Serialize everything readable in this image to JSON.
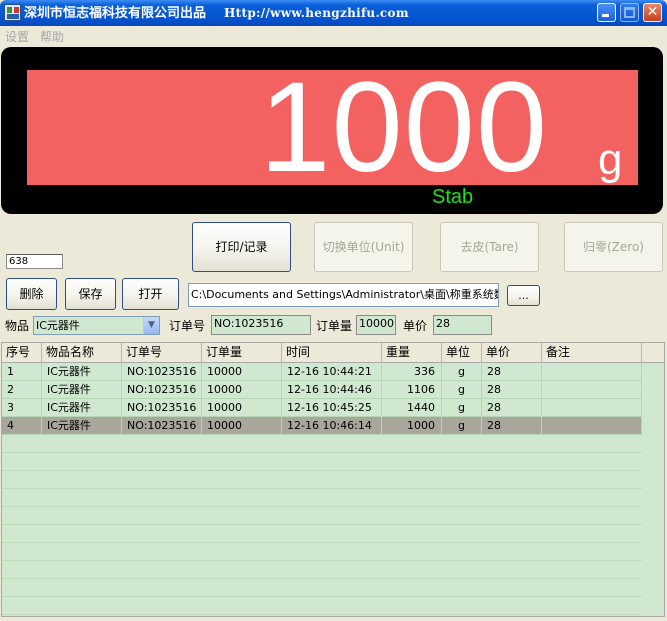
{
  "window": {
    "title": "深圳市恒志福科技有限公司出品",
    "url": "Http://www.hengzhifu.com"
  },
  "menu": [
    "设置",
    "帮助"
  ],
  "display": {
    "weight": "1000",
    "unit": "g",
    "status": "Stab",
    "screen_color": "#f36161"
  },
  "controls": {
    "print_record": "打印/记录",
    "switch_unit": "切换单位(Unit)",
    "tare": "去皮(Tare)",
    "zero": "归零(Zero)",
    "delete": "删除",
    "save": "保存",
    "open": "打开",
    "browse": "...",
    "value_field": "638",
    "file_path": "C:\\Documents and Settings\\Administrator\\桌面\\称重系统数据("
  },
  "item_row": {
    "item_label": "物品",
    "item_value": "IC元器件",
    "order_label": "订单号",
    "order_value": "NO:1023516",
    "qty_label": "订单量",
    "qty_value": "10000",
    "price_label": "单价",
    "price_value": "28"
  },
  "grid": {
    "columns": [
      "序号",
      "物品名称",
      "订单号",
      "订单量",
      "时间",
      "重量",
      "单位",
      "单价",
      "备注"
    ],
    "rows": [
      {
        "no": "1",
        "name": "IC元器件",
        "order": "NO:1023516",
        "qty": "10000",
        "time": "12-16 10:44:21",
        "weight": "336",
        "unit": "g",
        "price": "28",
        "note": ""
      },
      {
        "no": "2",
        "name": "IC元器件",
        "order": "NO:1023516",
        "qty": "10000",
        "time": "12-16 10:44:46",
        "weight": "1106",
        "unit": "g",
        "price": "28",
        "note": ""
      },
      {
        "no": "3",
        "name": "IC元器件",
        "order": "NO:1023516",
        "qty": "10000",
        "time": "12-16 10:45:25",
        "weight": "1440",
        "unit": "g",
        "price": "28",
        "note": ""
      },
      {
        "no": "4",
        "name": "IC元器件",
        "order": "NO:1023516",
        "qty": "10000",
        "time": "12-16 10:46:14",
        "weight": "1000",
        "unit": "g",
        "price": "28",
        "note": ""
      }
    ],
    "selected_row": 3
  }
}
